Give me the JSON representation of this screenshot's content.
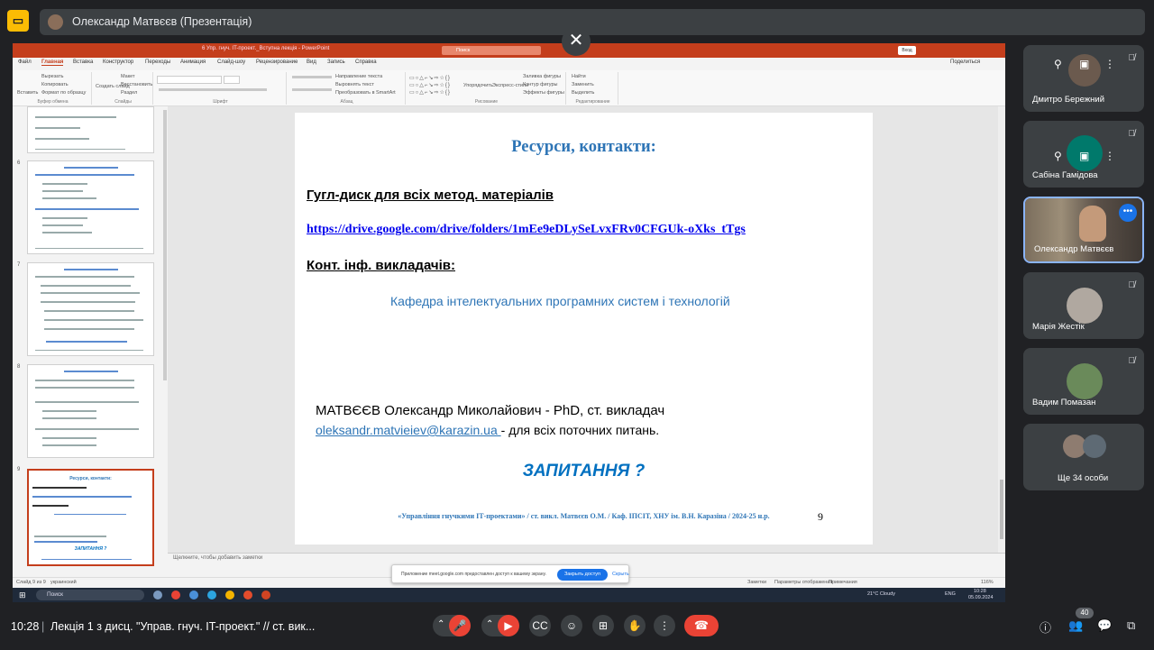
{
  "topbar": {
    "presenter_chip": "Олександр Матвєєв (Презентація)",
    "close_glyph": "✕"
  },
  "ppt": {
    "window_title": "6 Упр. гнуч. IT-проект._Вступна лекція - PowerPoint",
    "search_placeholder": "Поиск",
    "signin": "Вход",
    "tabs": [
      "Файл",
      "Главная",
      "Вставка",
      "Конструктор",
      "Переходы",
      "Анимация",
      "Слайд-шоу",
      "Рецензирование",
      "Вид",
      "Запись",
      "Справка"
    ],
    "share": "Поделиться",
    "ribbon_groups": [
      "Буфер обмена",
      "Слайды",
      "Шрифт",
      "Абзац",
      "Рисование",
      "Редактирование"
    ],
    "ribbon_items": {
      "paste": "Вставить",
      "cut": "Вырезать",
      "copy": "Копировать",
      "format": "Формат по образцу",
      "new_slide": "Создать слайд",
      "layout": "Макет",
      "reset": "Восстановить",
      "section": "Раздел",
      "text_dir": "Направление текста",
      "align_text": "Выровнять текст",
      "smartart": "Преобразовать в SmartArt",
      "arrange": "Упорядочить",
      "quick_styles": "Экспресс-стили",
      "fill": "Заливка фигуры",
      "outline": "Контур фигуры",
      "effects": "Эффекты фигуры",
      "find": "Найти",
      "replace": "Заменить",
      "select": "Выделить"
    },
    "thumb_numbers": [
      "6",
      "7",
      "8",
      "9"
    ],
    "thumb9_title": "Ресурси, контакти:",
    "thumb9_q": "ЗАПИТАННЯ ?",
    "notes_placeholder": "Щелкните, чтобы добавить заметки",
    "status_left": "Слайд 9 из 9",
    "status_lang": "украинский",
    "status_notes": "Заметки",
    "status_display": "Параметры отображения",
    "status_comments": "Примечания",
    "status_zoom": "116%"
  },
  "slide": {
    "title": "Ресурси, контакти:",
    "drive_heading": "Гугл-диск для всіх метод. матеріалів",
    "drive_link": "https://drive.google.com/drive/folders/1mEe9eDLySeLvxFRv0CFGUk-oXks_tTgs",
    "contacts_heading": "Конт. інф. викладачів:",
    "department": "Кафедра інтелектуальних програмних систем і технологій",
    "lecturer": "МАТВЄЄВ Олександр Миколайович -  PhD, ст. викладач",
    "email": "oleksandr.matvieiev@karazin.ua ",
    "email_suffix": "- для всіх поточних питань.",
    "question": "ЗАПИТАННЯ  ?",
    "footer": "«Управління гнучкими ІТ-проектами» / ст. викл. Матвєєв О.М. / Каф. ІПСІТ, ХНУ ім. В.Н. Каразіна / 2024-25 н.р.",
    "page_number": "9"
  },
  "notice": {
    "text": "Приложение meet.google.com предоставлен доступ к вашему экрану.",
    "stop": "Закрыть доступ",
    "hide": "Скрыть"
  },
  "taskbar": {
    "search": "Поиск",
    "weather": "21°C  Cloudy",
    "lang": "ENG",
    "time": "10:28",
    "date": "05.09.2024"
  },
  "participants": [
    {
      "name": "Дмитро Бережний"
    },
    {
      "name": "Сабіна Гамідова"
    },
    {
      "name": "Олександр Матвєєв"
    },
    {
      "name": "Марія Жестік"
    },
    {
      "name": "Вадим Помазан"
    },
    {
      "name": "Ще 34 особи"
    }
  ],
  "bottombar": {
    "time": "10:28",
    "meeting_title": "Лекція 1 з дисц. \"Управ. гнуч. IT-проект.\" // ст. вик...",
    "participant_count": "40"
  },
  "colors": {
    "accent_blue": "#1a73e8",
    "ppt_red": "#c43e1c",
    "end_call": "#ea4335",
    "slide_blue": "#2e75b6"
  }
}
